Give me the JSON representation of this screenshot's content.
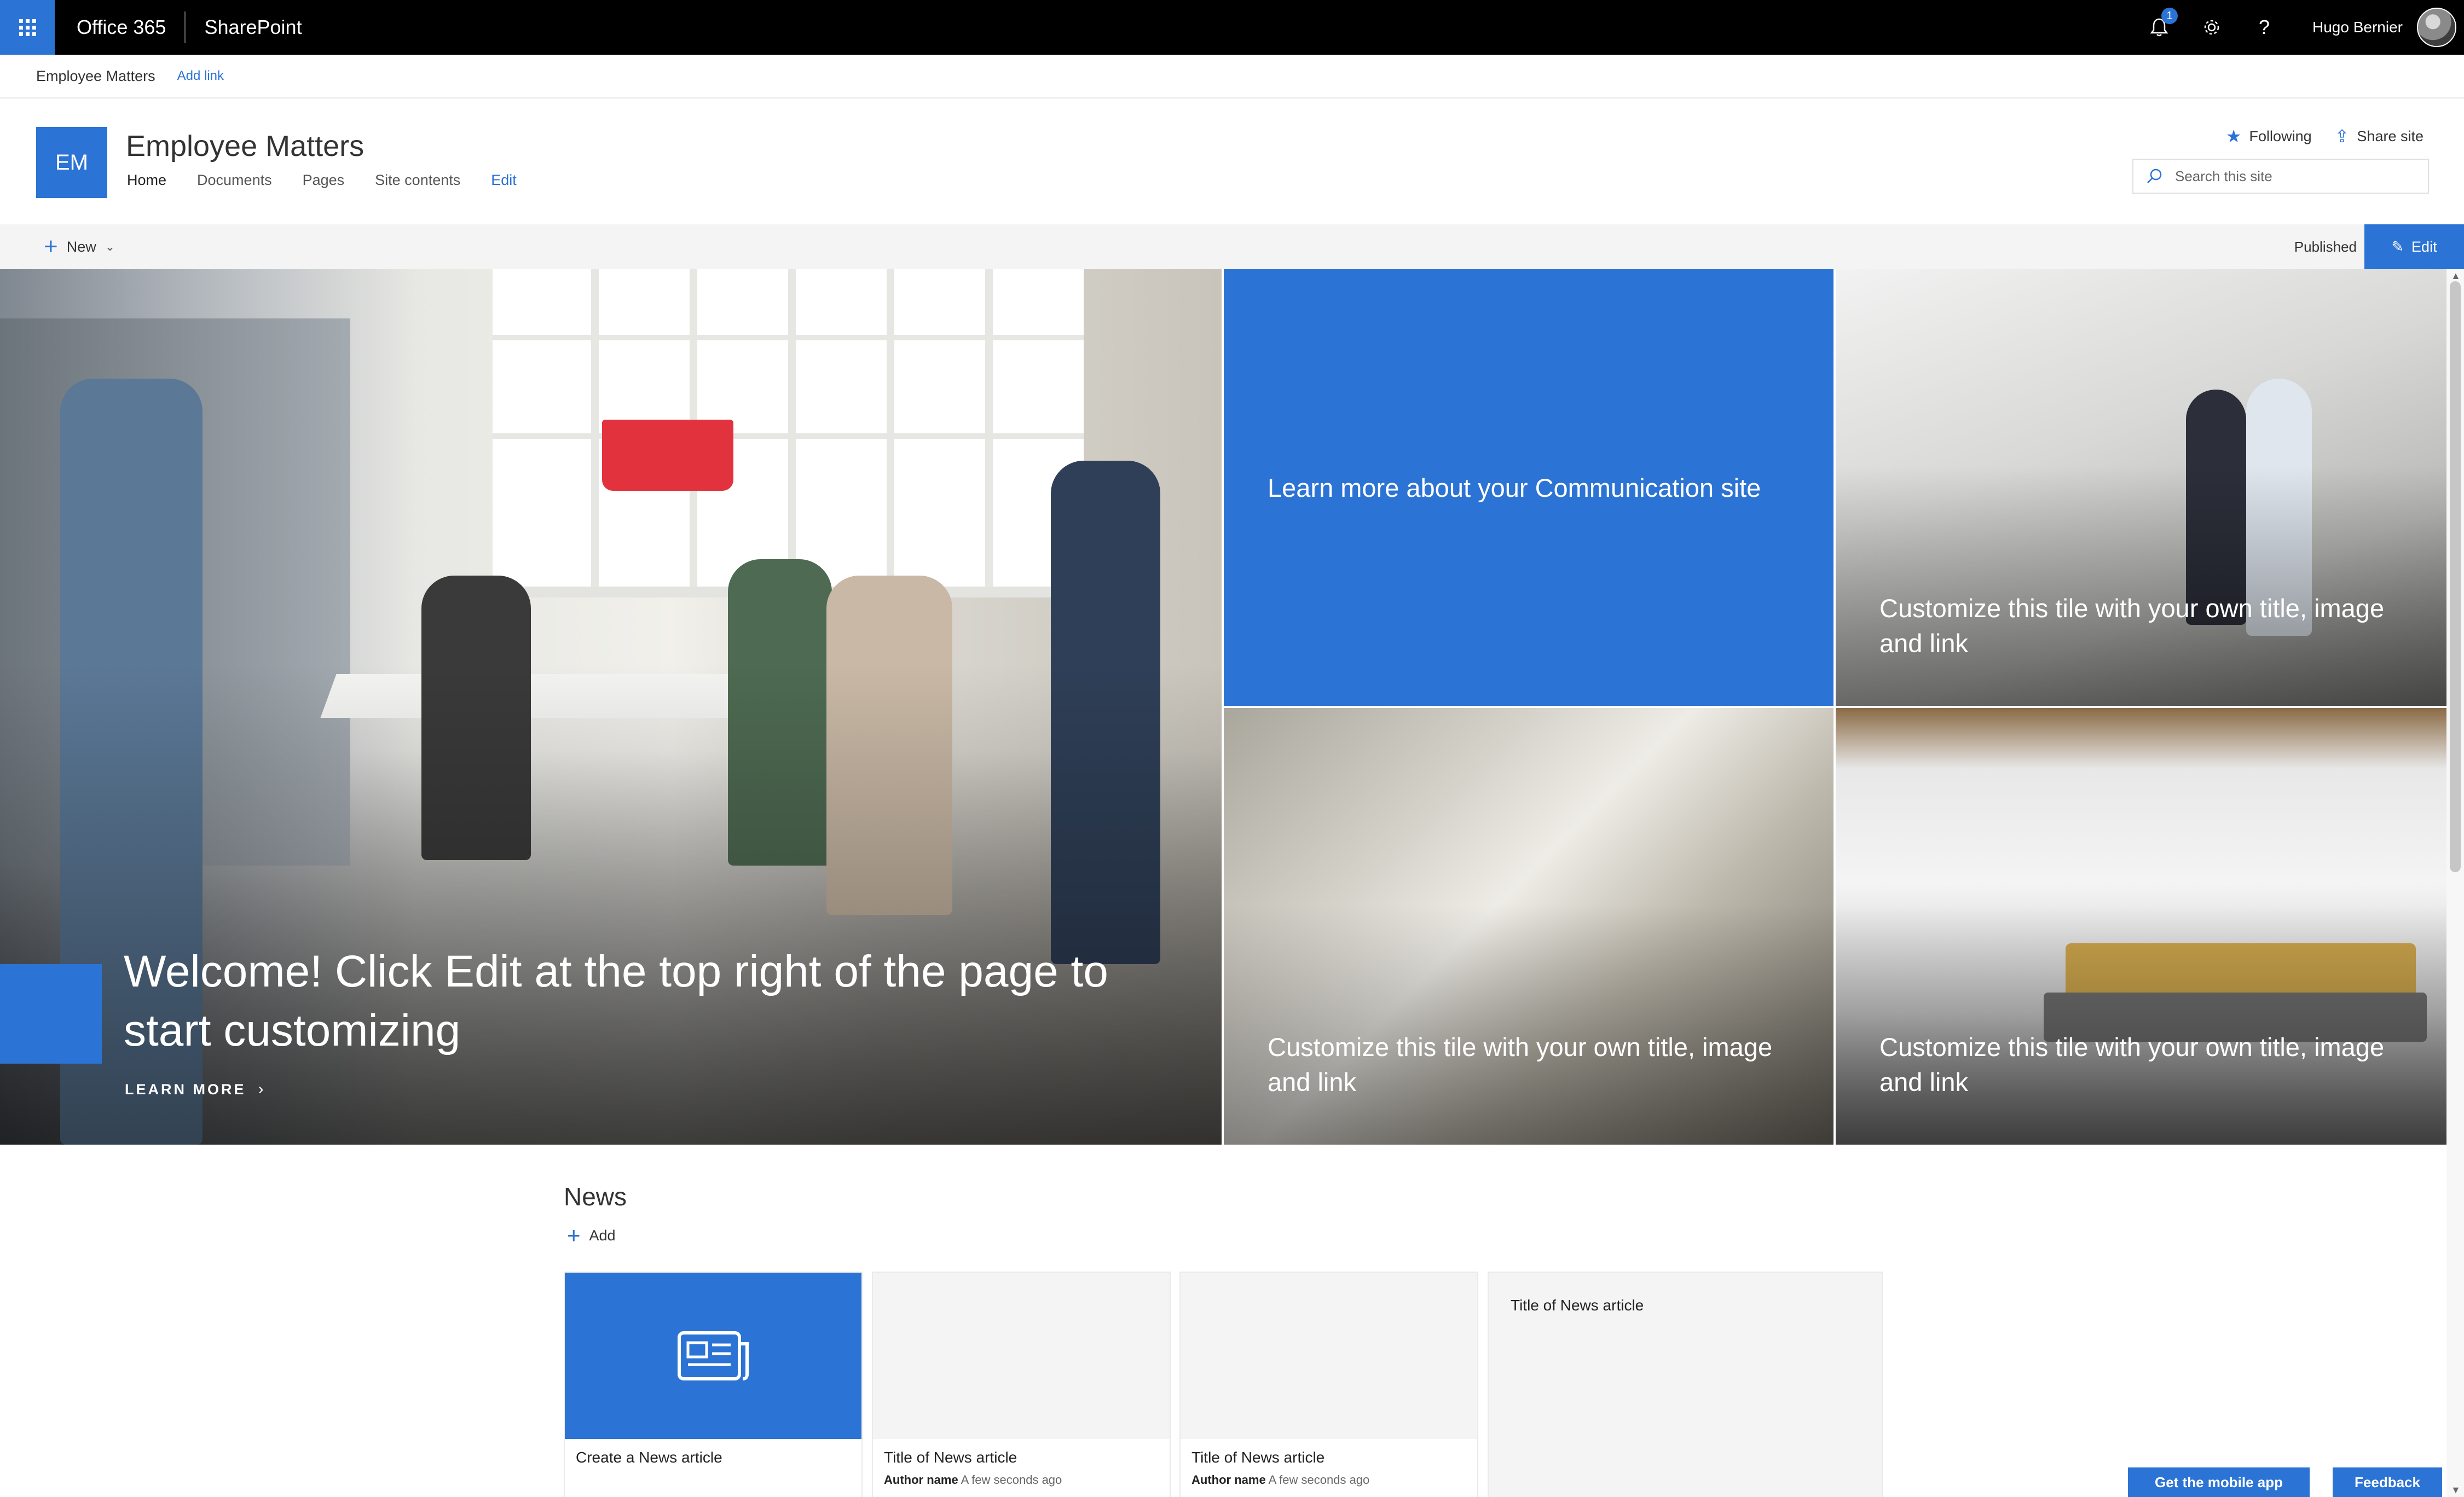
{
  "suitebar": {
    "app_launcher_icon": "waffle-icon",
    "brand": "Office 365",
    "app_name": "SharePoint",
    "notification_count": "1",
    "user_name": "Hugo Bernier"
  },
  "hubnav": {
    "title": "Employee Matters",
    "add_link": "Add link"
  },
  "site": {
    "logo_initials": "EM",
    "title": "Employee Matters",
    "nav": [
      "Home",
      "Documents",
      "Pages",
      "Site contents",
      "Edit"
    ],
    "following": "Following",
    "share": "Share site",
    "search_placeholder": "Search this site"
  },
  "commandbar": {
    "new_label": "New",
    "status": "Published",
    "edit_label": "Edit"
  },
  "hero": {
    "main_title": "Welcome! Click Edit at the top right of the page to start customizing",
    "learn_more": "LEARN MORE",
    "blue_tile": "Learn more about your Communication site",
    "tile_text": "Customize this tile with your own title, image and link"
  },
  "news": {
    "title": "News",
    "add_label": "Add",
    "cards": [
      {
        "title": "Create a News article",
        "author": "",
        "time": ""
      },
      {
        "title": "Title of News article",
        "author": "Author name",
        "time": "A few seconds ago"
      },
      {
        "title": "Title of News article",
        "author": "Author name",
        "time": "A few seconds ago"
      },
      {
        "title": "Title of News article",
        "author": "",
        "time": ""
      }
    ]
  },
  "footer": {
    "mobile_app": "Get the mobile app",
    "feedback": "Feedback"
  },
  "colors": {
    "accent": "#2b73d4",
    "suitebar": "#000000",
    "commandbar": "#f4f4f4"
  }
}
